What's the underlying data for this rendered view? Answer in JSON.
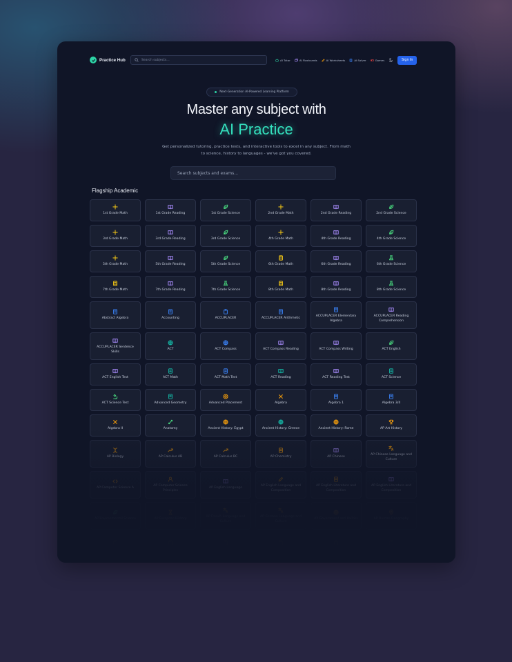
{
  "nav": {
    "logo_text": "Practice Hub",
    "search_placeholder": "Search subjects...",
    "links": [
      {
        "label": "AI Tutor",
        "icon": "bot-icon",
        "color": "#2dd4a6"
      },
      {
        "label": "AI Flashcards",
        "icon": "cards-icon",
        "color": "#a78bfa"
      },
      {
        "label": "AI Worksheets",
        "icon": "pencil-icon",
        "color": "#f59e0b"
      },
      {
        "label": "AI Solver",
        "icon": "calculator-icon",
        "color": "#3b82f6"
      },
      {
        "label": "Games",
        "icon": "gamepad-icon",
        "color": "#ef4444"
      }
    ],
    "signin_label": "Sign In"
  },
  "hero": {
    "badge": "Next-Generation AI-Powered Learning Platform",
    "headline_line1": "Master any subject with",
    "headline_line2": "AI Practice",
    "subtitle": "Get personalized tutoring, practice tests, and interactive tools to excel in any subject. From math to science, history to languages - we've got you covered.",
    "search_placeholder": "Search subjects and exams..."
  },
  "section": {
    "title": "Flagship Academic"
  },
  "colors": {
    "yellow": "#facc15",
    "purple": "#a78bfa",
    "green": "#4ade80",
    "blue": "#3b82f6",
    "teal": "#14b8a6",
    "orange": "#f59e0b",
    "brand": "#34e0bd",
    "button": "#2563eb"
  },
  "subjects": [
    {
      "label": "1st Grade Math",
      "icon": "sparkle-icon",
      "color": "yellow"
    },
    {
      "label": "1st Grade Reading",
      "icon": "book-icon",
      "color": "purple"
    },
    {
      "label": "1st Grade Science",
      "icon": "leaf-icon",
      "color": "green"
    },
    {
      "label": "2nd Grade Math",
      "icon": "sparkle-icon",
      "color": "yellow"
    },
    {
      "label": "2nd Grade Reading",
      "icon": "book-icon",
      "color": "purple"
    },
    {
      "label": "2nd Grade Science",
      "icon": "leaf-icon",
      "color": "green"
    },
    {
      "label": "3rd Grade Math",
      "icon": "sparkle-icon",
      "color": "yellow"
    },
    {
      "label": "3rd Grade Reading",
      "icon": "book-icon",
      "color": "purple"
    },
    {
      "label": "3rd Grade Science",
      "icon": "leaf-icon",
      "color": "green"
    },
    {
      "label": "4th Grade Math",
      "icon": "sparkle-icon",
      "color": "yellow"
    },
    {
      "label": "4th Grade Reading",
      "icon": "book-icon",
      "color": "purple"
    },
    {
      "label": "4th Grade Science",
      "icon": "leaf-icon",
      "color": "green"
    },
    {
      "label": "5th Grade Math",
      "icon": "sparkle-icon",
      "color": "yellow"
    },
    {
      "label": "5th Grade Reading",
      "icon": "book-icon",
      "color": "purple"
    },
    {
      "label": "5th Grade Science",
      "icon": "leaf-icon",
      "color": "green"
    },
    {
      "label": "6th Grade Math",
      "icon": "calculator-icon",
      "color": "yellow"
    },
    {
      "label": "6th Grade Reading",
      "icon": "book-icon",
      "color": "purple"
    },
    {
      "label": "6th Grade Science",
      "icon": "flask-icon",
      "color": "green"
    },
    {
      "label": "7th Grade Math",
      "icon": "calculator-icon",
      "color": "yellow"
    },
    {
      "label": "7th Grade Reading",
      "icon": "book-icon",
      "color": "purple"
    },
    {
      "label": "7th Grade Science",
      "icon": "flask-icon",
      "color": "green"
    },
    {
      "label": "8th Grade Math",
      "icon": "calculator-icon",
      "color": "yellow"
    },
    {
      "label": "8th Grade Reading",
      "icon": "book-icon",
      "color": "purple"
    },
    {
      "label": "8th Grade Science",
      "icon": "flask-icon",
      "color": "green"
    },
    {
      "label": "Abstract Algebra",
      "icon": "document-icon",
      "color": "blue"
    },
    {
      "label": "Accounting",
      "icon": "document-icon",
      "color": "blue"
    },
    {
      "label": "ACCUPLACER",
      "icon": "clipboard-icon",
      "color": "blue"
    },
    {
      "label": "ACCUPLACER Arithmetic",
      "icon": "document-icon",
      "color": "blue"
    },
    {
      "label": "ACCUPLACER Elementary Algebra",
      "icon": "document-icon",
      "color": "blue"
    },
    {
      "label": "ACCUPLACER Reading Comprehension",
      "icon": "book-icon",
      "color": "purple"
    },
    {
      "label": "ACCUPLACER Sentence Skills",
      "icon": "book-icon",
      "color": "purple"
    },
    {
      "label": "ACT",
      "icon": "globe-icon",
      "color": "teal"
    },
    {
      "label": "ACT Compass",
      "icon": "globe-icon",
      "color": "blue"
    },
    {
      "label": "ACT Compass Reading",
      "icon": "book-icon",
      "color": "purple"
    },
    {
      "label": "ACT Compass Writing",
      "icon": "book-icon",
      "color": "purple"
    },
    {
      "label": "ACT English",
      "icon": "leaf-icon",
      "color": "green"
    },
    {
      "label": "ACT English Test",
      "icon": "book-icon",
      "color": "purple"
    },
    {
      "label": "ACT Math",
      "icon": "document-icon",
      "color": "teal"
    },
    {
      "label": "ACT Math Test",
      "icon": "document-icon",
      "color": "blue"
    },
    {
      "label": "ACT Reading",
      "icon": "book-icon",
      "color": "teal"
    },
    {
      "label": "ACT Reading Test",
      "icon": "book-icon",
      "color": "purple"
    },
    {
      "label": "ACT Science",
      "icon": "document-icon",
      "color": "teal"
    },
    {
      "label": "ACT Science Test",
      "icon": "microscope-icon",
      "color": "green"
    },
    {
      "label": "Advanced Geometry",
      "icon": "document-icon",
      "color": "teal"
    },
    {
      "label": "Advanced Placement",
      "icon": "target-icon",
      "color": "orange"
    },
    {
      "label": "Algebra",
      "icon": "cross-icon",
      "color": "orange"
    },
    {
      "label": "Algebra 1",
      "icon": "document-icon",
      "color": "blue"
    },
    {
      "label": "Algebra 3/4",
      "icon": "document-icon",
      "color": "blue"
    },
    {
      "label": "Algebra II",
      "icon": "cross-icon",
      "color": "orange"
    },
    {
      "label": "Anatomy",
      "icon": "bone-icon",
      "color": "green"
    },
    {
      "label": "Ancient History: Egypt",
      "icon": "globe-icon",
      "color": "orange"
    },
    {
      "label": "Ancient History: Greece",
      "icon": "globe-icon",
      "color": "teal"
    },
    {
      "label": "Ancient History: Rome",
      "icon": "globe-icon",
      "color": "orange"
    },
    {
      "label": "AP Art History",
      "icon": "trophy-icon",
      "color": "orange"
    },
    {
      "label": "AP Biology",
      "icon": "dna-icon",
      "color": "orange"
    },
    {
      "label": "AP Calculus AB",
      "icon": "trend-icon",
      "color": "orange"
    },
    {
      "label": "AP Calculus BC",
      "icon": "trend-icon",
      "color": "orange"
    },
    {
      "label": "AP Chemistry",
      "icon": "document-icon",
      "color": "orange"
    },
    {
      "label": "AP Chinese",
      "icon": "book-icon",
      "color": "purple"
    },
    {
      "label": "AP Chinese Language and Culture",
      "icon": "translate-icon",
      "color": "orange"
    },
    {
      "label": "AP Computer Science A",
      "icon": "code-icon",
      "color": "orange"
    },
    {
      "label": "AP Computer Science Principles",
      "icon": "user-icon",
      "color": "orange"
    },
    {
      "label": "AP English Language",
      "icon": "book-icon",
      "color": "purple"
    },
    {
      "label": "AP English Language and Composition",
      "icon": "pen-icon",
      "color": "orange"
    },
    {
      "label": "AP English Literature and Composition",
      "icon": "document-icon",
      "color": "orange"
    },
    {
      "label": "AP English Literature and Composition",
      "icon": "book-icon",
      "color": "purple"
    },
    {
      "label": "AP Environmental Science",
      "icon": "leaf-icon",
      "color": "green"
    },
    {
      "label": "AP European History",
      "icon": "hourglass-icon",
      "color": "orange"
    },
    {
      "label": "AP French Language and Culture",
      "icon": "translate-icon",
      "color": "orange"
    },
    {
      "label": "AP German Language and Culture",
      "icon": "translate-icon",
      "color": "orange"
    },
    {
      "label": "AP Government and Politics",
      "icon": "globe-icon",
      "color": "orange"
    },
    {
      "label": "AP Human Geography",
      "icon": "pin-icon",
      "color": "orange"
    },
    {
      "label": "",
      "icon": "document-icon",
      "color": "orange"
    },
    {
      "label": "",
      "icon": "document-icon",
      "color": "orange"
    },
    {
      "label": "",
      "icon": "document-icon",
      "color": "orange"
    },
    {
      "label": "",
      "icon": "document-icon",
      "color": "orange"
    },
    {
      "label": "",
      "icon": "document-icon",
      "color": "orange"
    },
    {
      "label": "",
      "icon": "document-icon",
      "color": "orange"
    }
  ]
}
